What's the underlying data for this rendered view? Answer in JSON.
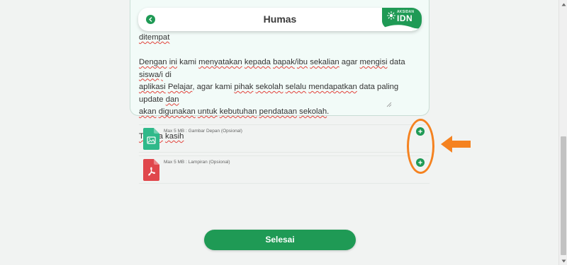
{
  "header": {
    "title": "Humas",
    "brand_tagline": "AKSIDAN",
    "brand_name": "IDN"
  },
  "message": {
    "lines": [
      [
        {
          "t": "ditempat",
          "s": true
        }
      ],
      [],
      [
        {
          "t": "Dengan",
          "s": true
        },
        {
          "t": " "
        },
        {
          "t": "ini",
          "s": true
        },
        {
          "t": " kami "
        },
        {
          "t": "menyatakan",
          "s": true
        },
        {
          "t": " "
        },
        {
          "t": "kepada",
          "s": true
        },
        {
          "t": " "
        },
        {
          "t": "bapak",
          "s": true
        },
        {
          "t": "/"
        },
        {
          "t": "ibu",
          "s": true
        },
        {
          "t": " "
        },
        {
          "t": "sekalian",
          "s": true
        },
        {
          "t": " agar "
        },
        {
          "t": "mengisi",
          "s": true
        },
        {
          "t": " data "
        },
        {
          "t": "siswa",
          "s": true
        },
        {
          "t": "/"
        },
        {
          "t": "i",
          "s": true
        },
        {
          "t": " di"
        }
      ],
      [
        {
          "t": "aplikasi",
          "s": true
        },
        {
          "t": " "
        },
        {
          "t": "Pelajar",
          "s": true
        },
        {
          "t": ", agar kami "
        },
        {
          "t": "pihak",
          "s": true
        },
        {
          "t": " "
        },
        {
          "t": "sekolah",
          "s": true
        },
        {
          "t": " "
        },
        {
          "t": "selalu",
          "s": true
        },
        {
          "t": " "
        },
        {
          "t": "mendapatkan",
          "s": true
        },
        {
          "t": " data paling update "
        },
        {
          "t": "dan",
          "s": true
        }
      ],
      [
        {
          "t": "akan",
          "s": true
        },
        {
          "t": " "
        },
        {
          "t": "digunakan",
          "s": true
        },
        {
          "t": " "
        },
        {
          "t": "untuk",
          "s": true
        },
        {
          "t": " "
        },
        {
          "t": "kebutuhan",
          "s": true
        },
        {
          "t": " "
        },
        {
          "t": "pendataan",
          "s": true
        },
        {
          "t": " "
        },
        {
          "t": "sekolah",
          "s": true
        },
        {
          "t": "."
        }
      ],
      [],
      [
        {
          "t": "Terima",
          "s": true
        },
        {
          "t": " "
        },
        {
          "t": "kasih",
          "s": true
        }
      ]
    ]
  },
  "attachments": [
    {
      "label": "Max 5 MB : Gambar Depan (Opsional)",
      "icon": "image-file-icon",
      "color": "#2fb98a"
    },
    {
      "label": "Max 5 MB : Lampiran (Opsional)",
      "icon": "pdf-file-icon",
      "color": "#e0474c"
    }
  ],
  "submit_label": "Selesai",
  "colors": {
    "primary": "#1f9a55",
    "highlight": "#f58220",
    "image_icon": "#2fb98a",
    "pdf_icon": "#e0474c"
  }
}
